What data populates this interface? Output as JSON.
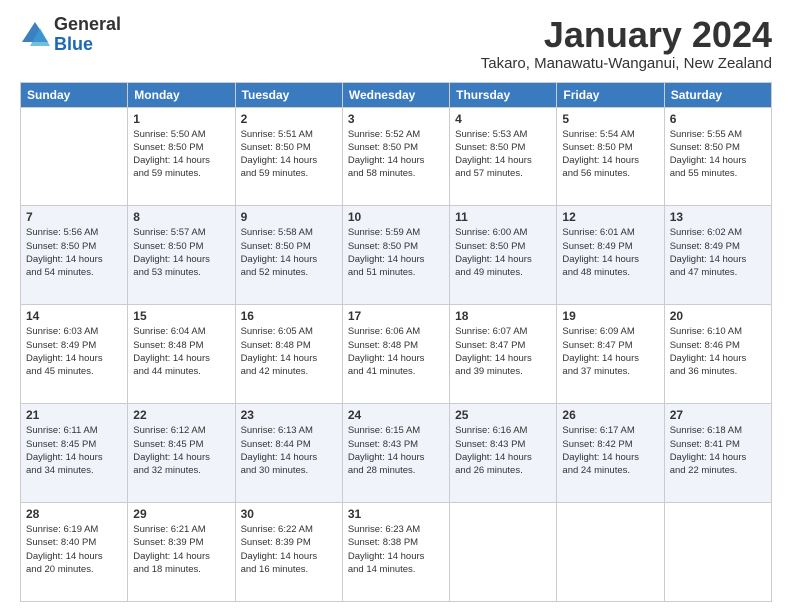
{
  "logo": {
    "general": "General",
    "blue": "Blue"
  },
  "title": "January 2024",
  "subtitle": "Takaro, Manawatu-Wanganui, New Zealand",
  "weekdays": [
    "Sunday",
    "Monday",
    "Tuesday",
    "Wednesday",
    "Thursday",
    "Friday",
    "Saturday"
  ],
  "weeks": [
    [
      {
        "day": "",
        "info": ""
      },
      {
        "day": "1",
        "info": "Sunrise: 5:50 AM\nSunset: 8:50 PM\nDaylight: 14 hours\nand 59 minutes."
      },
      {
        "day": "2",
        "info": "Sunrise: 5:51 AM\nSunset: 8:50 PM\nDaylight: 14 hours\nand 59 minutes."
      },
      {
        "day": "3",
        "info": "Sunrise: 5:52 AM\nSunset: 8:50 PM\nDaylight: 14 hours\nand 58 minutes."
      },
      {
        "day": "4",
        "info": "Sunrise: 5:53 AM\nSunset: 8:50 PM\nDaylight: 14 hours\nand 57 minutes."
      },
      {
        "day": "5",
        "info": "Sunrise: 5:54 AM\nSunset: 8:50 PM\nDaylight: 14 hours\nand 56 minutes."
      },
      {
        "day": "6",
        "info": "Sunrise: 5:55 AM\nSunset: 8:50 PM\nDaylight: 14 hours\nand 55 minutes."
      }
    ],
    [
      {
        "day": "7",
        "info": "Sunrise: 5:56 AM\nSunset: 8:50 PM\nDaylight: 14 hours\nand 54 minutes."
      },
      {
        "day": "8",
        "info": "Sunrise: 5:57 AM\nSunset: 8:50 PM\nDaylight: 14 hours\nand 53 minutes."
      },
      {
        "day": "9",
        "info": "Sunrise: 5:58 AM\nSunset: 8:50 PM\nDaylight: 14 hours\nand 52 minutes."
      },
      {
        "day": "10",
        "info": "Sunrise: 5:59 AM\nSunset: 8:50 PM\nDaylight: 14 hours\nand 51 minutes."
      },
      {
        "day": "11",
        "info": "Sunrise: 6:00 AM\nSunset: 8:50 PM\nDaylight: 14 hours\nand 49 minutes."
      },
      {
        "day": "12",
        "info": "Sunrise: 6:01 AM\nSunset: 8:49 PM\nDaylight: 14 hours\nand 48 minutes."
      },
      {
        "day": "13",
        "info": "Sunrise: 6:02 AM\nSunset: 8:49 PM\nDaylight: 14 hours\nand 47 minutes."
      }
    ],
    [
      {
        "day": "14",
        "info": "Sunrise: 6:03 AM\nSunset: 8:49 PM\nDaylight: 14 hours\nand 45 minutes."
      },
      {
        "day": "15",
        "info": "Sunrise: 6:04 AM\nSunset: 8:48 PM\nDaylight: 14 hours\nand 44 minutes."
      },
      {
        "day": "16",
        "info": "Sunrise: 6:05 AM\nSunset: 8:48 PM\nDaylight: 14 hours\nand 42 minutes."
      },
      {
        "day": "17",
        "info": "Sunrise: 6:06 AM\nSunset: 8:48 PM\nDaylight: 14 hours\nand 41 minutes."
      },
      {
        "day": "18",
        "info": "Sunrise: 6:07 AM\nSunset: 8:47 PM\nDaylight: 14 hours\nand 39 minutes."
      },
      {
        "day": "19",
        "info": "Sunrise: 6:09 AM\nSunset: 8:47 PM\nDaylight: 14 hours\nand 37 minutes."
      },
      {
        "day": "20",
        "info": "Sunrise: 6:10 AM\nSunset: 8:46 PM\nDaylight: 14 hours\nand 36 minutes."
      }
    ],
    [
      {
        "day": "21",
        "info": "Sunrise: 6:11 AM\nSunset: 8:45 PM\nDaylight: 14 hours\nand 34 minutes."
      },
      {
        "day": "22",
        "info": "Sunrise: 6:12 AM\nSunset: 8:45 PM\nDaylight: 14 hours\nand 32 minutes."
      },
      {
        "day": "23",
        "info": "Sunrise: 6:13 AM\nSunset: 8:44 PM\nDaylight: 14 hours\nand 30 minutes."
      },
      {
        "day": "24",
        "info": "Sunrise: 6:15 AM\nSunset: 8:43 PM\nDaylight: 14 hours\nand 28 minutes."
      },
      {
        "day": "25",
        "info": "Sunrise: 6:16 AM\nSunset: 8:43 PM\nDaylight: 14 hours\nand 26 minutes."
      },
      {
        "day": "26",
        "info": "Sunrise: 6:17 AM\nSunset: 8:42 PM\nDaylight: 14 hours\nand 24 minutes."
      },
      {
        "day": "27",
        "info": "Sunrise: 6:18 AM\nSunset: 8:41 PM\nDaylight: 14 hours\nand 22 minutes."
      }
    ],
    [
      {
        "day": "28",
        "info": "Sunrise: 6:19 AM\nSunset: 8:40 PM\nDaylight: 14 hours\nand 20 minutes."
      },
      {
        "day": "29",
        "info": "Sunrise: 6:21 AM\nSunset: 8:39 PM\nDaylight: 14 hours\nand 18 minutes."
      },
      {
        "day": "30",
        "info": "Sunrise: 6:22 AM\nSunset: 8:39 PM\nDaylight: 14 hours\nand 16 minutes."
      },
      {
        "day": "31",
        "info": "Sunrise: 6:23 AM\nSunset: 8:38 PM\nDaylight: 14 hours\nand 14 minutes."
      },
      {
        "day": "",
        "info": ""
      },
      {
        "day": "",
        "info": ""
      },
      {
        "day": "",
        "info": ""
      }
    ]
  ]
}
